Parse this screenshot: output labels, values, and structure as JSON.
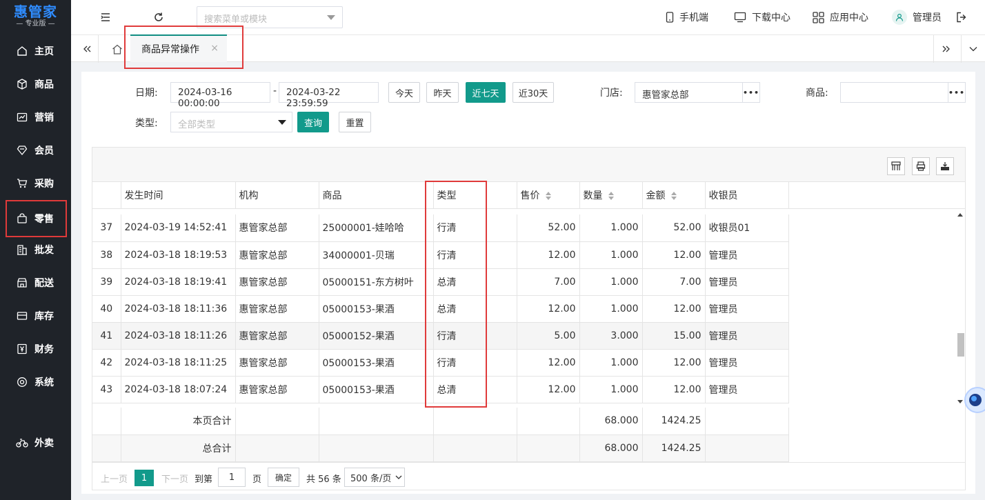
{
  "logo": {
    "main": "惠管家",
    "sub": "— 专业版 —"
  },
  "sidebar": {
    "items": [
      {
        "label": "主页",
        "icon": "home-icon"
      },
      {
        "label": "商品",
        "icon": "box-icon"
      },
      {
        "label": "营销",
        "icon": "chart-icon"
      },
      {
        "label": "会员",
        "icon": "diamond-icon"
      },
      {
        "label": "采购",
        "icon": "cart-icon"
      },
      {
        "label": "零售",
        "icon": "bag-icon"
      },
      {
        "label": "批发",
        "icon": "building-icon"
      },
      {
        "label": "配送",
        "icon": "store-icon"
      },
      {
        "label": "库存",
        "icon": "inbox-icon"
      },
      {
        "label": "财务",
        "icon": "yen-icon"
      },
      {
        "label": "系统",
        "icon": "target-icon"
      },
      {
        "label": "外卖",
        "icon": "bike-icon"
      }
    ]
  },
  "topbar": {
    "search_placeholder": "搜索菜单或模块",
    "mobile": "手机端",
    "download": "下载中心",
    "apps": "应用中心",
    "user": "管理员"
  },
  "tabs": {
    "active": "商品异常操作",
    "close": "×"
  },
  "filters": {
    "date_label": "日期:",
    "date_start": "2024-03-16 00:00:00",
    "date_sep": "-",
    "date_end": "2024-03-22 23:59:59",
    "today": "今天",
    "yesterday": "昨天",
    "last7": "近七天",
    "last30": "近30天",
    "store_label": "门店:",
    "store_value": "惠管家总部",
    "product_label": "商品:",
    "product_value": "",
    "type_label": "类型:",
    "type_placeholder": "全部类型",
    "query": "查询",
    "reset": "重置",
    "dots": "•••"
  },
  "table": {
    "headers": [
      "",
      "发生时间",
      "机构",
      "商品",
      "类型",
      "售价",
      "数量",
      "金额",
      "收银员"
    ],
    "rows": [
      [
        "37",
        "2024-03-19 14:52:41",
        "惠管家总部",
        "25000001-娃哈哈",
        "行清",
        "52.00",
        "1.000",
        "52.00",
        "收银员01"
      ],
      [
        "38",
        "2024-03-18 18:19:53",
        "惠管家总部",
        "34000001-贝瑞",
        "行清",
        "12.00",
        "1.000",
        "12.00",
        "管理员"
      ],
      [
        "39",
        "2024-03-18 18:19:41",
        "惠管家总部",
        "05000151-东方树叶",
        "总清",
        "7.00",
        "1.000",
        "7.00",
        "管理员"
      ],
      [
        "40",
        "2024-03-18 18:11:36",
        "惠管家总部",
        "05000153-果酒",
        "总清",
        "12.00",
        "1.000",
        "12.00",
        "管理员"
      ],
      [
        "41",
        "2024-03-18 18:11:26",
        "惠管家总部",
        "05000152-果酒",
        "行清",
        "5.00",
        "3.000",
        "15.00",
        "管理员"
      ],
      [
        "42",
        "2024-03-18 18:11:25",
        "惠管家总部",
        "05000153-果酒",
        "行清",
        "12.00",
        "1.000",
        "12.00",
        "管理员"
      ],
      [
        "43",
        "2024-03-18 18:07:24",
        "惠管家总部",
        "05000153-果酒",
        "总清",
        "12.00",
        "1.000",
        "12.00",
        "管理员"
      ]
    ],
    "page_total_label": "本页合计",
    "page_total_qty": "68.000",
    "page_total_amount": "1424.25",
    "grand_total_label": "总合计",
    "grand_total_qty": "68.000",
    "grand_total_amount": "1424.25"
  },
  "pager": {
    "prev": "上一页",
    "current": "1",
    "next": "下一页",
    "goto": "到第",
    "page_input": "1",
    "page_unit": "页",
    "confirm": "确定",
    "total": "共 56 条",
    "page_size": "500 条/页"
  }
}
